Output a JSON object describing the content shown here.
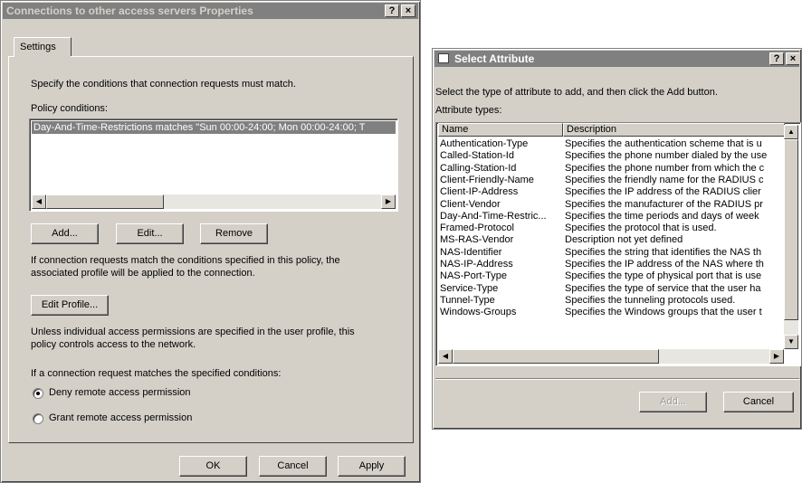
{
  "left_dialog": {
    "title": "Connections to other access servers Properties",
    "help_btn": "?",
    "close_btn": "×",
    "tab": "Settings",
    "intro": "Specify the conditions that connection requests must match.",
    "policy_label": "Policy conditions:",
    "condition": "Day-And-Time-Restrictions matches \"Sun 00:00-24:00; Mon 00:00-24:00; T",
    "add": "Add...",
    "edit": "Edit...",
    "remove": "Remove",
    "info1a": "If connection requests match the conditions specified in this policy, the",
    "info1b": "associated profile will be applied to the connection.",
    "edit_profile": "Edit Profile...",
    "info2a": "Unless individual access permissions are specified in the user profile, this",
    "info2b": "policy controls access to the network.",
    "if_match": "If a connection request matches the specified conditions:",
    "deny": "Deny remote access permission",
    "grant": "Grant remote access permission",
    "selected_option": "deny",
    "ok": "OK",
    "cancel": "Cancel",
    "apply": "Apply"
  },
  "right_dialog": {
    "title": "Select Attribute",
    "help_btn": "?",
    "close_btn": "×",
    "intro": "Select the type of attribute to add, and then click the Add button.",
    "types_label": "Attribute types:",
    "col_name": "Name",
    "col_desc": "Description",
    "rows": [
      {
        "name": "Authentication-Type",
        "desc": "Specifies the authentication scheme that is u"
      },
      {
        "name": "Called-Station-Id",
        "desc": "Specifies the phone number dialed by the use"
      },
      {
        "name": "Calling-Station-Id",
        "desc": "Specifies the phone number from which the c"
      },
      {
        "name": "Client-Friendly-Name",
        "desc": "Specifies the friendly name for the RADIUS c"
      },
      {
        "name": "Client-IP-Address",
        "desc": "Specifies the IP address of the RADIUS clier"
      },
      {
        "name": "Client-Vendor",
        "desc": "Specifies the manufacturer of the RADIUS pr"
      },
      {
        "name": "Day-And-Time-Restric...",
        "desc": "Specifies the time periods and days of week"
      },
      {
        "name": "Framed-Protocol",
        "desc": "Specifies the protocol that is used."
      },
      {
        "name": "MS-RAS-Vendor",
        "desc": "Description not yet defined"
      },
      {
        "name": "NAS-Identifier",
        "desc": "Specifies the string that identifies the NAS th"
      },
      {
        "name": "NAS-IP-Address",
        "desc": "Specifies the IP address of the NAS where th"
      },
      {
        "name": "NAS-Port-Type",
        "desc": "Specifies the type of physical port that is use"
      },
      {
        "name": "Service-Type",
        "desc": "Specifies the type of service that the user ha"
      },
      {
        "name": "Tunnel-Type",
        "desc": "Specifies the tunneling protocols used."
      },
      {
        "name": "Windows-Groups",
        "desc": "Specifies the Windows groups that the user t"
      }
    ],
    "add": "Add...",
    "cancel": "Cancel"
  }
}
